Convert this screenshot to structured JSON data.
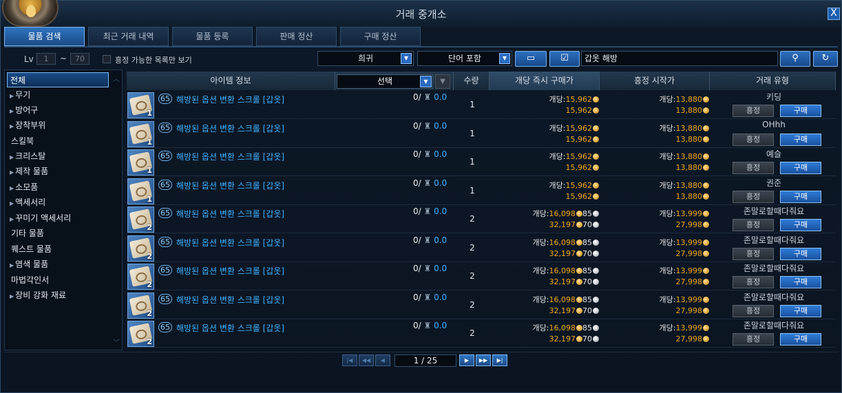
{
  "window": {
    "title": "거래 중개소",
    "close_label": "X"
  },
  "tabs": [
    {
      "label": "물품 검색",
      "active": true
    },
    {
      "label": "최근 거래 내역",
      "active": false
    },
    {
      "label": "물품 등록",
      "active": false
    },
    {
      "label": "판매 정산",
      "active": false
    },
    {
      "label": "구매 정산",
      "active": false
    }
  ],
  "filters": {
    "lv_label": "Lv",
    "lv_min": "1",
    "lv_sep": "~",
    "lv_max": "70",
    "bid_only_label": "흥정 가능한 목록만 보기",
    "rarity": "희귀",
    "match_mode": "단어 포함",
    "search_value": "갑옷 해방"
  },
  "categories": [
    {
      "label": "전체",
      "arrow": "",
      "active": true
    },
    {
      "label": "무기",
      "arrow": "▶"
    },
    {
      "label": "방어구",
      "arrow": "▶"
    },
    {
      "label": "장착부위",
      "arrow": "▶"
    },
    {
      "label": "스킬북",
      "arrow": ""
    },
    {
      "label": "크리스탈",
      "arrow": "▶"
    },
    {
      "label": "제작 물품",
      "arrow": "▶"
    },
    {
      "label": "소모품",
      "arrow": "▶"
    },
    {
      "label": "액세서리",
      "arrow": "▶"
    },
    {
      "label": "꾸미기 액세서리",
      "arrow": "▶"
    },
    {
      "label": "기타 물품",
      "arrow": ""
    },
    {
      "label": "퀘스트 물품",
      "arrow": ""
    },
    {
      "label": "염색 물품",
      "arrow": "▶"
    },
    {
      "label": "마법각인서",
      "arrow": ""
    },
    {
      "label": "장비 강화 재료",
      "arrow": "▶"
    }
  ],
  "columns": {
    "item_info": "아이템 정보",
    "select": "선택",
    "qty": "수량",
    "instant_price": "개당 즉시 구매가",
    "bid_start": "흥정 시작가",
    "trade_type": "거래 유형"
  },
  "rows": [
    {
      "qty_badge": "1",
      "level": "65",
      "name": "해방된 옵션 변환 스크롤 [갑옷]",
      "stock": "0/",
      "stock_val": "0.0",
      "count": "1",
      "unit_label": "개당:",
      "unit_price": "15,962",
      "unit_silver": "",
      "total_price": "15,962",
      "total_silver": "",
      "bid_unit": "13,880",
      "bid_total": "13,880",
      "seller": "키딩",
      "bid_btn": "흥정",
      "buy_btn": "구매"
    },
    {
      "qty_badge": "1",
      "level": "65",
      "name": "해방된 옵션 변환 스크롤 [갑옷]",
      "stock": "0/",
      "stock_val": "0.0",
      "count": "1",
      "unit_label": "개당:",
      "unit_price": "15,962",
      "unit_silver": "",
      "total_price": "15,962",
      "total_silver": "",
      "bid_unit": "13,880",
      "bid_total": "13,880",
      "seller": "OHhh",
      "bid_btn": "흥정",
      "buy_btn": "구매"
    },
    {
      "qty_badge": "1",
      "level": "65",
      "name": "해방된 옵션 변환 스크롤 [갑옷]",
      "stock": "0/",
      "stock_val": "0.0",
      "count": "1",
      "unit_label": "개당:",
      "unit_price": "15,962",
      "unit_silver": "",
      "total_price": "15,962",
      "total_silver": "",
      "bid_unit": "13,880",
      "bid_total": "13,880",
      "seller": "예슬",
      "bid_btn": "흥정",
      "buy_btn": "구매"
    },
    {
      "qty_badge": "1",
      "level": "65",
      "name": "해방된 옵션 변환 스크롤 [갑옷]",
      "stock": "0/",
      "stock_val": "0.0",
      "count": "1",
      "unit_label": "개당:",
      "unit_price": "15,962",
      "unit_silver": "",
      "total_price": "15,962",
      "total_silver": "",
      "bid_unit": "13,880",
      "bid_total": "13,880",
      "seller": "권준",
      "bid_btn": "흥정",
      "buy_btn": "구매"
    },
    {
      "qty_badge": "2",
      "level": "65",
      "name": "해방된 옵션 변환 스크롤 [갑옷]",
      "stock": "0/",
      "stock_val": "0.0",
      "count": "2",
      "unit_label": "개당:",
      "unit_price": "16,098",
      "unit_silver": "85",
      "total_price": "32,197",
      "total_silver": "70",
      "bid_unit": "13,999",
      "bid_total": "27,998",
      "seller": "존말로할때다줘요",
      "bid_btn": "흥정",
      "buy_btn": "구매"
    },
    {
      "qty_badge": "2",
      "level": "65",
      "name": "해방된 옵션 변환 스크롤 [갑옷]",
      "stock": "0/",
      "stock_val": "0.0",
      "count": "2",
      "unit_label": "개당:",
      "unit_price": "16,098",
      "unit_silver": "85",
      "total_price": "32,197",
      "total_silver": "70",
      "bid_unit": "13,999",
      "bid_total": "27,998",
      "seller": "존말로할때다줘요",
      "bid_btn": "흥정",
      "buy_btn": "구매"
    },
    {
      "qty_badge": "2",
      "level": "65",
      "name": "해방된 옵션 변환 스크롤 [갑옷]",
      "stock": "0/",
      "stock_val": "0.0",
      "count": "2",
      "unit_label": "개당:",
      "unit_price": "16,098",
      "unit_silver": "85",
      "total_price": "32,197",
      "total_silver": "70",
      "bid_unit": "13,999",
      "bid_total": "27,998",
      "seller": "존말로할때다줘요",
      "bid_btn": "흥정",
      "buy_btn": "구매"
    },
    {
      "qty_badge": "2",
      "level": "65",
      "name": "해방된 옵션 변환 스크롤 [갑옷]",
      "stock": "0/",
      "stock_val": "0.0",
      "count": "2",
      "unit_label": "개당:",
      "unit_price": "16,098",
      "unit_silver": "85",
      "total_price": "32,197",
      "total_silver": "70",
      "bid_unit": "13,999",
      "bid_total": "27,998",
      "seller": "존말로할때다줘요",
      "bid_btn": "흥정",
      "buy_btn": "구매"
    },
    {
      "qty_badge": "2",
      "level": "65",
      "name": "해방된 옵션 변환 스크롤 [갑옷]",
      "stock": "0/",
      "stock_val": "0.0",
      "count": "2",
      "unit_label": "개당:",
      "unit_price": "16,098",
      "unit_silver": "85",
      "total_price": "32,197",
      "total_silver": "70",
      "bid_unit": "13,999",
      "bid_total": "27,998",
      "seller": "존말로할때다줘요",
      "bid_btn": "흥정",
      "buy_btn": "구매"
    }
  ],
  "pager": {
    "indicator": "1 / 25"
  },
  "colors": {
    "accent": "#2f74c0",
    "link": "#3fb2ff",
    "gold": "#f2a81a"
  },
  "icons": [
    "search-icon",
    "refresh-icon",
    "mailbox-icon",
    "checkbox-icon",
    "scroll-icon",
    "gold-coin-icon",
    "silver-coin-icon"
  ]
}
